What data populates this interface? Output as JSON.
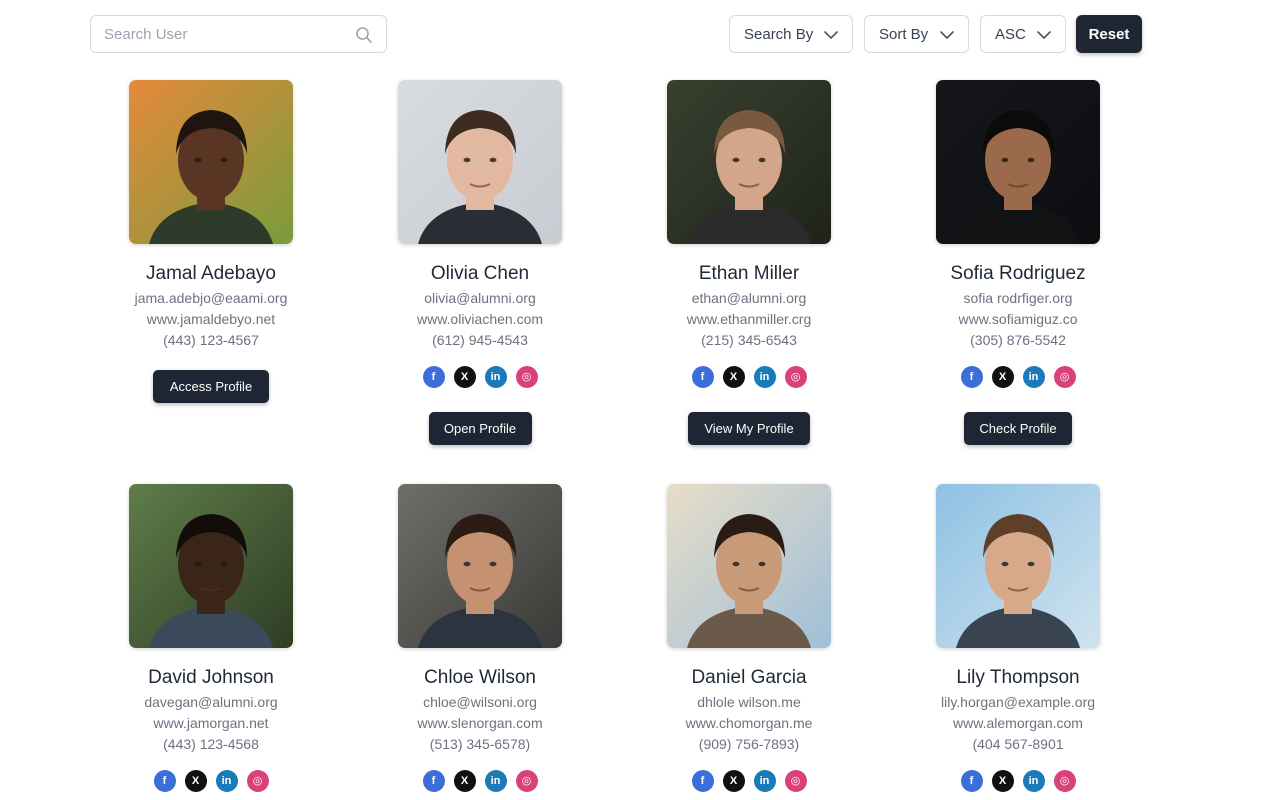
{
  "toolbar": {
    "search_placeholder": "Search User",
    "search_by_label": "Search By",
    "sort_by_label": "Sort By",
    "order_label": "ASC",
    "reset_label": "Reset"
  },
  "users": [
    {
      "name": "Jamal Adebayo",
      "email": "jama.adebjo@eaami.org",
      "website": "www.jamaldebyo.net",
      "phone": "(443) 123-4567",
      "button": "Access Profile",
      "has_socials": false
    },
    {
      "name": "Olivia Chen",
      "email": "olivia@alumni.org",
      "website": "www.oliviachen.com",
      "phone": "(612) 945-4543",
      "button": "Open Profile",
      "has_socials": true
    },
    {
      "name": "Ethan Miller",
      "email": "ethan@alumni.org",
      "website": "www.ethanmiller.crg",
      "phone": "(215) 345-6543",
      "button": "View My Profile",
      "has_socials": true
    },
    {
      "name": "Sofia Rodriguez",
      "email": "sofia rodrfiger.org",
      "website": "www.sofiamiguz.co",
      "phone": "(305) 876-5542",
      "button": "Check Profile",
      "has_socials": true
    },
    {
      "name": "David Johnson",
      "email": "davegan@alumni.org",
      "website": "www.jamorgan.net",
      "phone": "(443) 123-4568",
      "button": "",
      "has_socials": true
    },
    {
      "name": "Chloe Wilson",
      "email": "chloe@wilsoni.org",
      "website": "www.slenorgan.com",
      "phone": "(513) 345-6578)",
      "button": "",
      "has_socials": true
    },
    {
      "name": "Daniel Garcia",
      "email": "dhlole wilson.me",
      "website": "www.chomorgan.me",
      "phone": "(909) 756-7893)",
      "button": "",
      "has_socials": true
    },
    {
      "name": "Lily Thompson",
      "email": "lily.horgan@example.org",
      "website": "www.alemorgan.com",
      "phone": "(404 567-8901",
      "button": "",
      "has_socials": true
    }
  ],
  "social_icons": [
    "facebook-icon",
    "x-twitter-icon",
    "linkedin-icon",
    "instagram-icon"
  ],
  "social_glyphs": {
    "facebook": "f",
    "x": "X",
    "linkedin": "in",
    "instagram": "◎"
  },
  "colors": {
    "button_bg": "#1f2633",
    "facebook": "#3b6ed8",
    "x": "#111111",
    "linkedin": "#1b7ab8",
    "instagram": "#d8417a"
  }
}
